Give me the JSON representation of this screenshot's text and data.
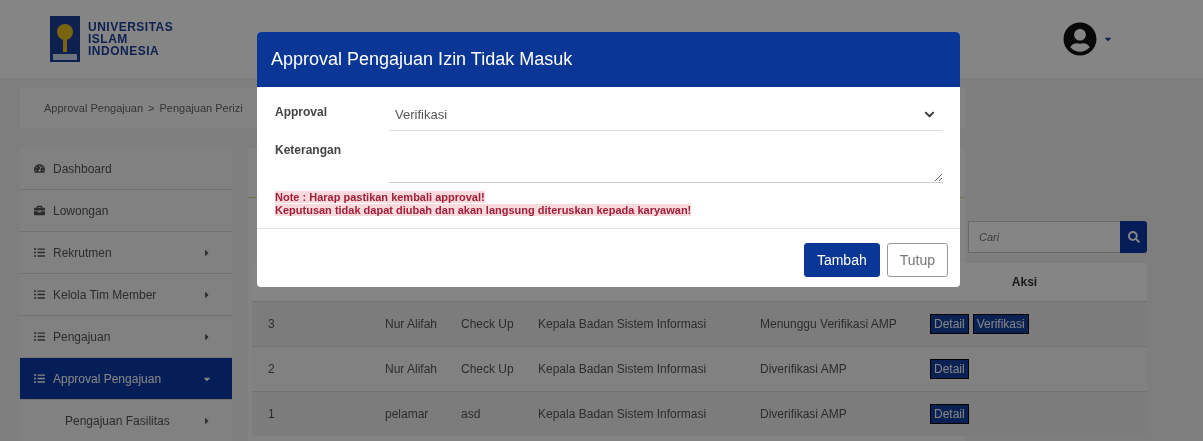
{
  "brand": {
    "lines": [
      "UNIVERSITAS",
      "ISLAM",
      "INDONESIA"
    ]
  },
  "breadcrumb": {
    "items": [
      "Approval Pengajuan",
      "Pengajuan Perizi"
    ],
    "separator": ">"
  },
  "sidebar": {
    "items": [
      {
        "label": "Dashboard",
        "kind": "dashboard",
        "selected": false
      },
      {
        "label": "Lowongan",
        "kind": "briefcase",
        "selected": false
      },
      {
        "label": "Rekrutmen",
        "kind": "menu",
        "selected": false,
        "expanded": false
      },
      {
        "label": "Kelola Tim Member",
        "kind": "menu",
        "selected": false,
        "expanded": false
      },
      {
        "label": "Pengajuan",
        "kind": "menu",
        "selected": false,
        "expanded": false
      },
      {
        "label": "Approval Pengajuan",
        "kind": "menu",
        "selected": true,
        "expanded": true,
        "children": [
          {
            "label": "Pengajuan Fasilitas",
            "expanded": false
          }
        ]
      }
    ]
  },
  "search": {
    "placeholder": "Cari"
  },
  "table": {
    "aksi_heading": "Aksi",
    "rows": [
      {
        "no": "3",
        "name": "Nur Alifah",
        "type": "Check Up",
        "position": "Kepala Badan Sistem Informasi",
        "status": "Menunggu Verifikasi AMP",
        "actions": [
          "Detail",
          "Verifikasi"
        ]
      },
      {
        "no": "2",
        "name": "Nur Alifah",
        "type": "Check Up",
        "position": "Kepala Badan Sistem Informasi",
        "status": "Diverifikasi AMP",
        "actions": [
          "Detail"
        ]
      },
      {
        "no": "1",
        "name": "pelamar",
        "type": "asd",
        "position": "Kepala Badan Sistem Informasi",
        "status": "Diverifikasi AMP",
        "actions": [
          "Detail"
        ]
      }
    ]
  },
  "modal": {
    "title": "Approval Pengajuan Izin Tidak Masuk",
    "fields": [
      {
        "label": "Approval",
        "kind": "select",
        "value": "Verifikasi"
      },
      {
        "label": "Keterangan",
        "kind": "textarea"
      }
    ],
    "notes": [
      "Note : Harap pastikan kembali approval!",
      "Keputusan tidak dapat diubah dan akan langsung diteruskan kepada karyawan!"
    ],
    "buttons": [
      {
        "label": "Tambah",
        "kind": "primary"
      },
      {
        "label": "Tutup",
        "kind": "secondary"
      }
    ]
  }
}
